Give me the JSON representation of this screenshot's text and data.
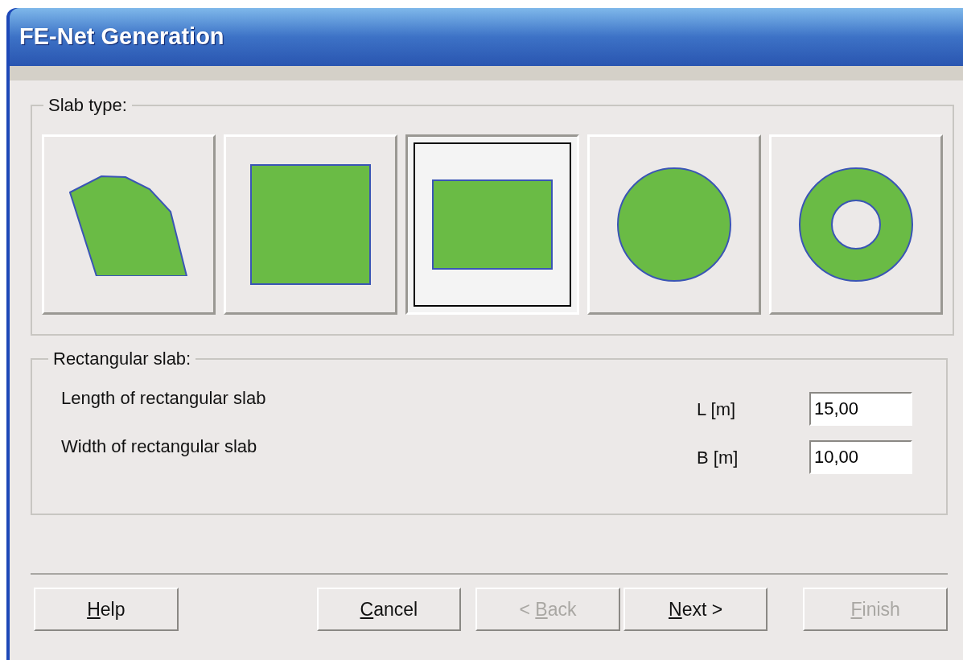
{
  "window": {
    "title": "FE-Net Generation"
  },
  "slab_type": {
    "label": "Slab type:",
    "options": [
      {
        "kind": "polygon",
        "selected": false
      },
      {
        "kind": "square",
        "selected": false
      },
      {
        "kind": "rectangle",
        "selected": true
      },
      {
        "kind": "circle",
        "selected": false
      },
      {
        "kind": "ring",
        "selected": false
      }
    ]
  },
  "rectangular_slab": {
    "label": "Rectangular slab:",
    "rows": [
      {
        "description": "Length of rectangular slab",
        "unit_label": "L [m]",
        "value": "15,00"
      },
      {
        "description": "Width of rectangular slab",
        "unit_label": "B [m]",
        "value": "10,00"
      }
    ]
  },
  "buttons": [
    {
      "access_key": "H",
      "label_rest": "elp",
      "disabled": false
    },
    {
      "access_key": "C",
      "label_rest": "ancel",
      "disabled": false
    },
    {
      "label_start": "< ",
      "access_key": "B",
      "label_rest": "ack",
      "disabled": true
    },
    {
      "access_key": "N",
      "label_rest": "ext >",
      "disabled": false
    },
    {
      "access_key": "F",
      "label_rest": "inish",
      "disabled": true
    }
  ]
}
